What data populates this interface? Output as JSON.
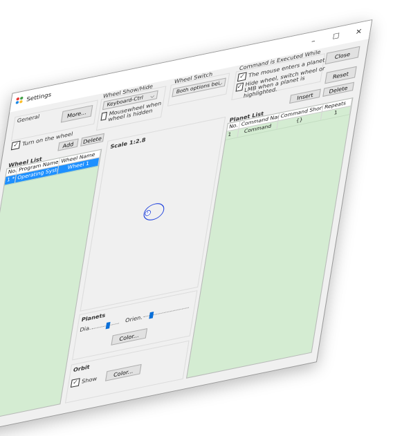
{
  "window": {
    "title": "Settings",
    "minimize": "–",
    "maximize": "☐",
    "close": "✕"
  },
  "buttons": {
    "close": "Close",
    "reset": "Reset",
    "more": "More...",
    "add": "Add",
    "delete": "Delete",
    "insert": "Insert",
    "planet_delete": "Delete",
    "planet_color": "Color...",
    "orbit_color": "Color..."
  },
  "general": {
    "label": "General",
    "turn_on": "Turn on the wheel"
  },
  "wheel_show": {
    "label": "Wheel Show/Hide",
    "combo": "Keyboard-Ctrl",
    "mousewheel": "Mousewheel when wheel is hidden"
  },
  "wheel_switch": {
    "label": "Wheel Switch",
    "combo": "Both options bei"
  },
  "command_exec": {
    "label": "Command is Executed While",
    "opt1": "The mouse enters a planet.",
    "opt2": "Hide wheel, switch wheel or LMB when a planet is highlighted."
  },
  "wheel_list": {
    "label": "Wheel List",
    "columns": [
      "No.",
      "Program Name",
      "Wheel Name"
    ],
    "rows": [
      [
        "1 *",
        "Operating System",
        "Wheel 1"
      ]
    ]
  },
  "preview": {
    "scale": "Scale 1:2.8",
    "planet_number": "1"
  },
  "planets": {
    "label": "Planets",
    "dia": "Dia.",
    "orien": "Orien.",
    "dia_value": 0.6,
    "orien_value": 0.15
  },
  "orbit": {
    "label": "Orbit",
    "show": "Show"
  },
  "planet_list": {
    "label": "Planet List",
    "columns": [
      "No.",
      "Command Name",
      "Command Shortcu",
      "Repeats"
    ],
    "rows": [
      [
        "1",
        "Command",
        "{}",
        "1"
      ]
    ]
  },
  "colors": {
    "grid": "#d4ecd2",
    "selection": "#1e90ff",
    "accent": "#0a6fd8"
  }
}
